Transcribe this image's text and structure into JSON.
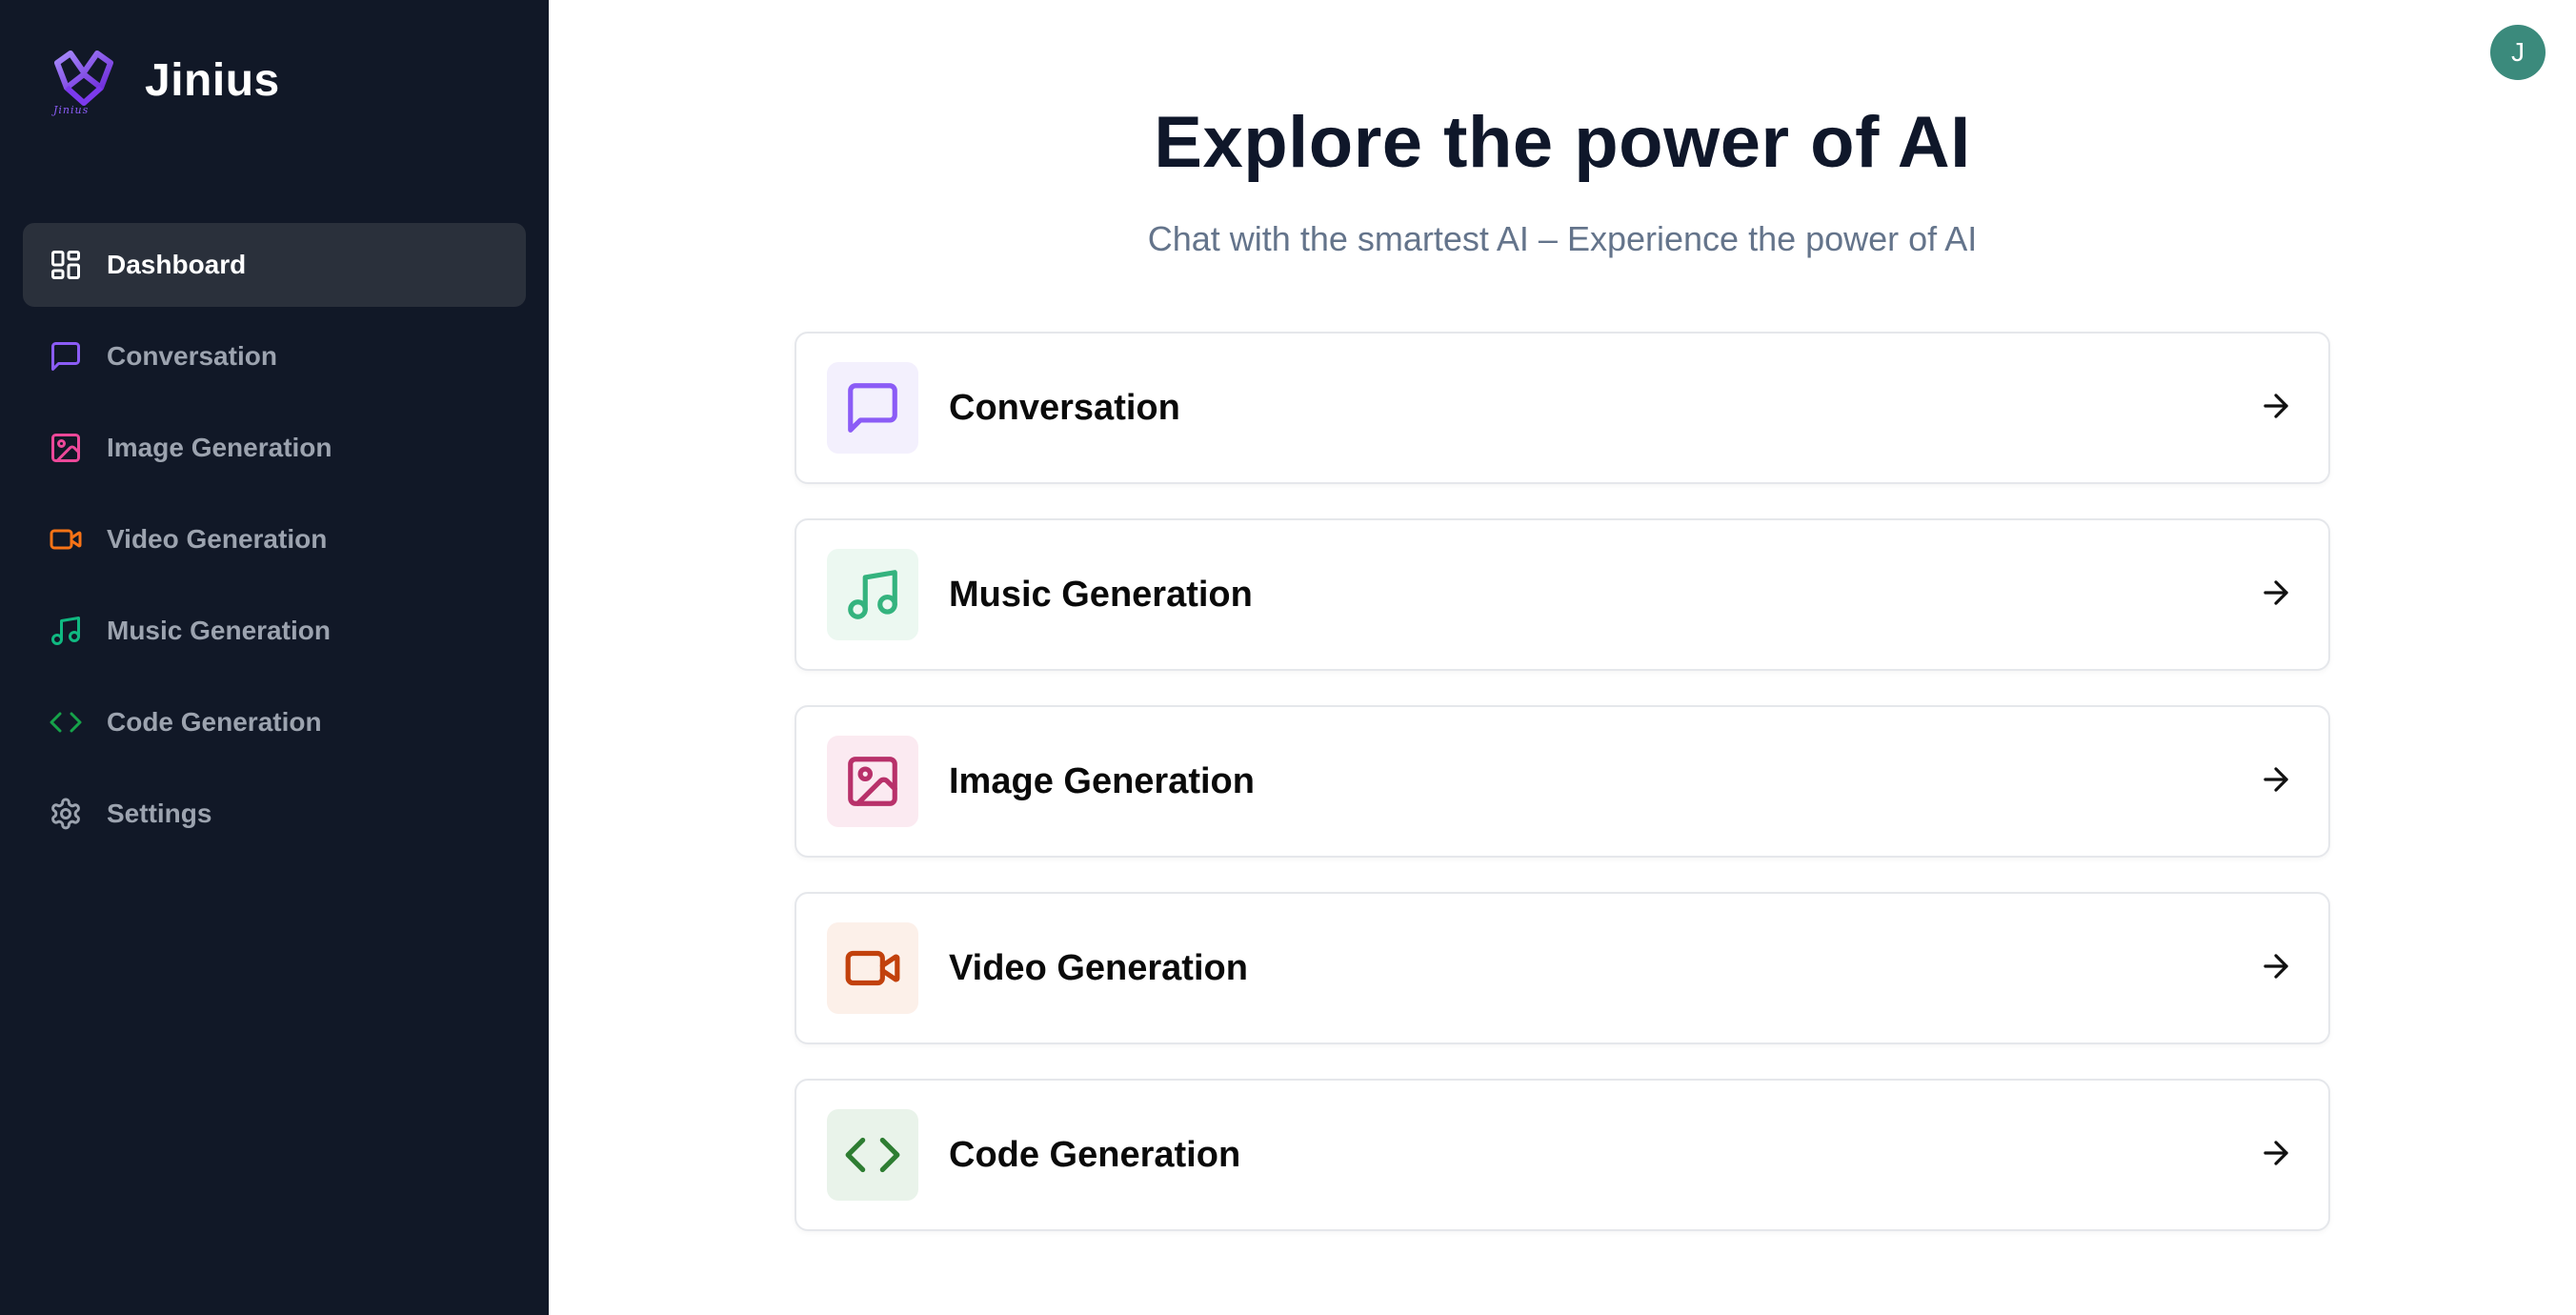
{
  "brand": {
    "name": "Jinius",
    "logo_text": "Jinius"
  },
  "sidebar": {
    "items": [
      {
        "label": "Dashboard",
        "icon": "layout-dashboard-icon",
        "color": "#ffffff",
        "active": true
      },
      {
        "label": "Conversation",
        "icon": "message-square-icon",
        "color": "#8b5cf6"
      },
      {
        "label": "Image Generation",
        "icon": "image-icon",
        "color": "#ec4899"
      },
      {
        "label": "Video Generation",
        "icon": "video-icon",
        "color": "#f97316"
      },
      {
        "label": "Music Generation",
        "icon": "music-icon",
        "color": "#10b981"
      },
      {
        "label": "Code Generation",
        "icon": "code-icon",
        "color": "#16a34a"
      },
      {
        "label": "Settings",
        "icon": "settings-icon",
        "color": "#9ca3af"
      }
    ]
  },
  "user": {
    "avatar_initial": "J",
    "avatar_color": "#3b8a7c"
  },
  "main": {
    "title": "Explore the power of AI",
    "subtitle": "Chat with the smartest AI – Experience the power of AI",
    "cards": [
      {
        "label": "Conversation",
        "icon": "message-square-icon",
        "color": "#8b5cf6",
        "bg": "#f3f0fd"
      },
      {
        "label": "Music Generation",
        "icon": "music-icon",
        "color": "#34b37e",
        "bg": "#ecf8f1"
      },
      {
        "label": "Image Generation",
        "icon": "image-icon",
        "color": "#b8316a",
        "bg": "#fbeaf1"
      },
      {
        "label": "Video Generation",
        "icon": "video-icon",
        "color": "#c2410c",
        "bg": "#fcf0e9"
      },
      {
        "label": "Code Generation",
        "icon": "code-icon",
        "color": "#2e7d32",
        "bg": "#e9f3ea"
      }
    ]
  }
}
